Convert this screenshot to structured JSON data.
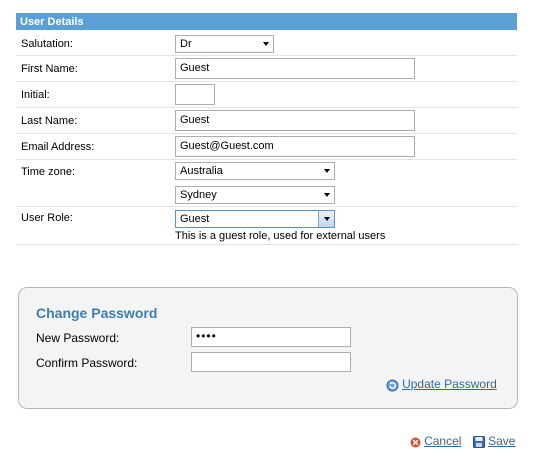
{
  "section": {
    "title": "User Details"
  },
  "fields": {
    "salutation": {
      "label": "Salutation:",
      "value": "Dr"
    },
    "first_name": {
      "label": "First Name:",
      "value": "Guest"
    },
    "initial": {
      "label": "Initial:",
      "value": ""
    },
    "last_name": {
      "label": "Last Name:",
      "value": "Guest"
    },
    "email": {
      "label": "Email Address:",
      "value": "Guest@Guest.com"
    },
    "timezone": {
      "label": "Time zone:",
      "region": "Australia",
      "city": "Sydney"
    },
    "user_role": {
      "label": "User Role:",
      "value": "Guest",
      "hint": "This is a guest role, used for external users"
    }
  },
  "change_password": {
    "title": "Change Password",
    "new_label": "New Password:",
    "new_value": "••••",
    "confirm_label": "Confirm Password:",
    "confirm_value": "",
    "update_link": "Update Password"
  },
  "actions": {
    "cancel": "Cancel",
    "save": "Save"
  },
  "colors": {
    "header_bg": "#5aa0d6",
    "accent_title": "#3b7fb2",
    "link": "#2c6aa6",
    "cancel_icon": "#d9532c",
    "save_icon": "#3b6fb3"
  }
}
